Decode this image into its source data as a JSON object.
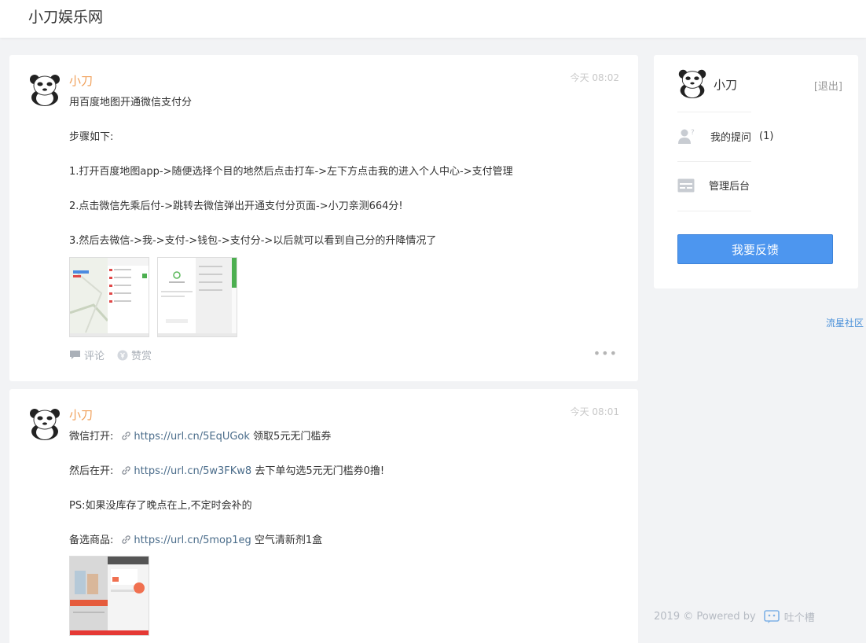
{
  "header": {
    "site_title": "小刀娱乐网"
  },
  "posts": [
    {
      "author": "小刀",
      "time": "今天 08:02",
      "lines": [
        "用百度地图开通微信支付分",
        "步骤如下:",
        "1.打开百度地图app->随便选择个目的地然后点击打车->左下方点击我的进入个人中心->支付管理",
        "2.点击微信先乘后付->跳转去微信弹出开通支付分页面->小刀亲测664分!",
        "3.然后去微信->我->支付->钱包->支付分->以后就可以看到自己分的升降情况了"
      ],
      "actions": {
        "comment": "评论",
        "reward": "赞赏"
      }
    },
    {
      "author": "小刀",
      "time": "今天 08:01",
      "lines": [
        {
          "prefix": "微信打开:",
          "url": "https://url.cn/5EqUGok",
          "suffix": "领取5元无门槛券"
        },
        {
          "prefix": "然后在开:",
          "url": "https://url.cn/5w3FKw8",
          "suffix": "去下单勾选5元无门槛券0撸!"
        },
        {
          "text": "PS:如果没库存了晚点在上,不定时会补的"
        },
        {
          "prefix": "备选商品:",
          "url": "https://url.cn/5mop1eg",
          "suffix": "空气清新剂1盒"
        }
      ]
    }
  ],
  "sidebar": {
    "user_name": "小刀",
    "logout": "[退出]",
    "my_questions_label": "我的提问",
    "my_questions_count": "(1)",
    "admin_label": "管理后台",
    "feedback_button": "我要反馈"
  },
  "community_link": "流星社区",
  "footer": {
    "copyright": "2019 © Powered by",
    "brand": "吐个槽"
  },
  "colors": {
    "accent": "#4d96ef",
    "author": "#f0a05a",
    "link": "#4a6c8a"
  },
  "icons": [
    "panda-avatar-icon",
    "link-icon",
    "comment-icon",
    "reward-icon",
    "more-icon",
    "user-question-icon",
    "admin-card-icon",
    "tucao-logo-icon"
  ]
}
